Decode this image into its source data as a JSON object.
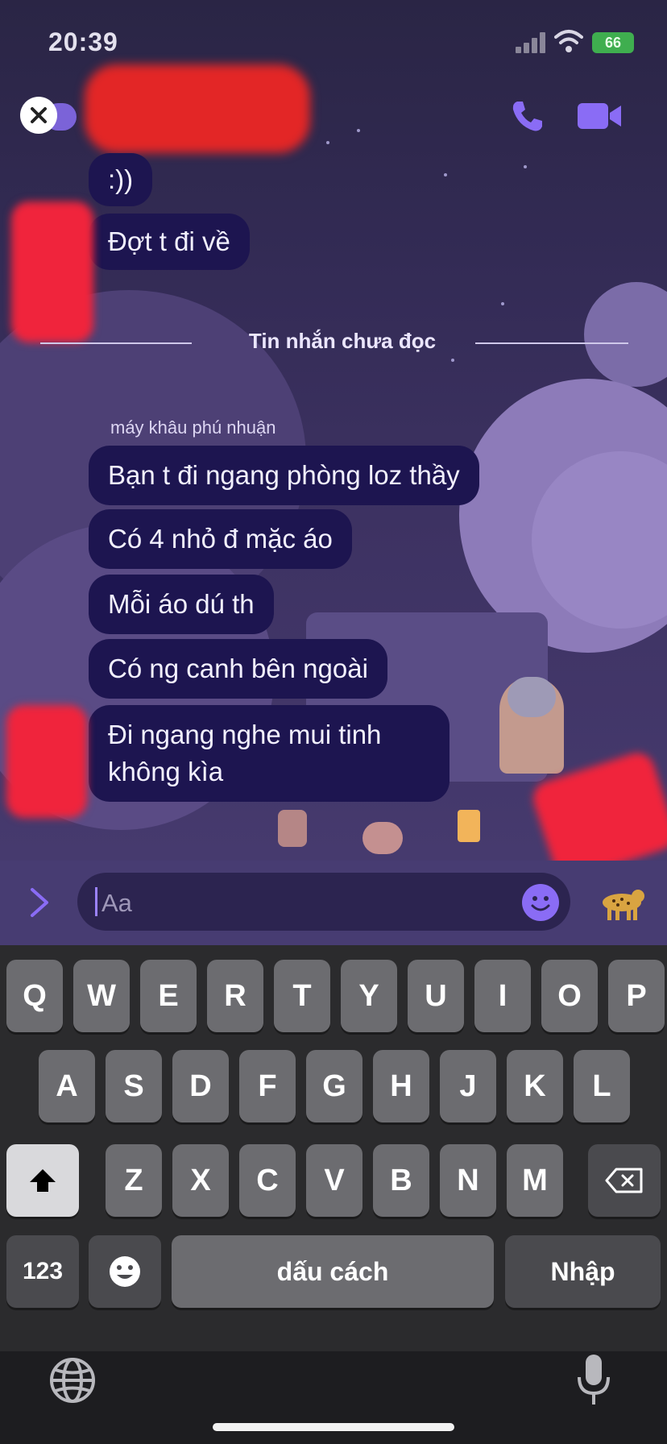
{
  "status_bar": {
    "time": "20:39",
    "battery": "66"
  },
  "chat": {
    "messages_before": [
      ":))",
      "Đợt t đi về"
    ],
    "unread_divider": "Tin nhắn chưa đọc",
    "sender": "máy khâu phú nhuận",
    "messages_after": [
      "Bạn t đi ngang phòng loz thầy",
      "Có 4 nhỏ đ mặc áo",
      "Mỗi áo dú th",
      "Có ng canh bên ngoài",
      "Đi ngang nghe mui tinh không kìa"
    ]
  },
  "composer": {
    "placeholder": "Aa"
  },
  "keyboard": {
    "row1": [
      "Q",
      "W",
      "E",
      "R",
      "T",
      "Y",
      "U",
      "I",
      "O",
      "P"
    ],
    "row2": [
      "A",
      "S",
      "D",
      "F",
      "G",
      "H",
      "J",
      "K",
      "L"
    ],
    "row3": [
      "Z",
      "X",
      "C",
      "V",
      "B",
      "N",
      "M"
    ],
    "numbers_key": "123",
    "space_key": "dấu cách",
    "return_key": "Nhập"
  },
  "colors": {
    "accent": "#8a6cf5",
    "bubble": "#1d1550",
    "redaction": "#f0243c"
  }
}
